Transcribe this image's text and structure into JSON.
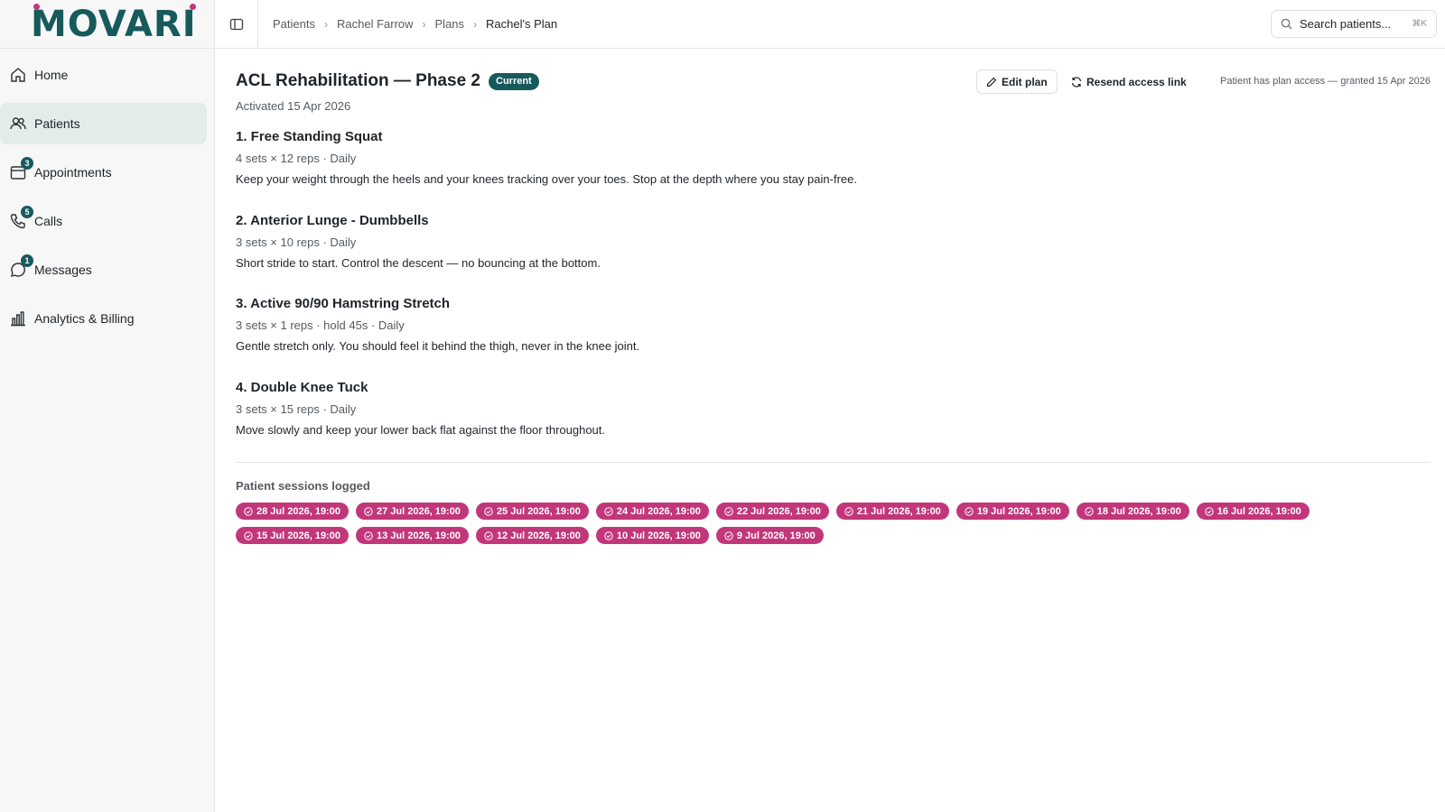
{
  "brand": {
    "name": "MOVARI",
    "accent": "#175a5c",
    "highlight": "#c2367a"
  },
  "sidebar": {
    "items": [
      {
        "label": "Home",
        "icon": "home-icon",
        "active": false
      },
      {
        "label": "Patients",
        "icon": "users-icon",
        "active": true
      },
      {
        "label": "Appointments",
        "icon": "calendar-icon",
        "badge": "3"
      },
      {
        "label": "Calls",
        "icon": "phone-icon",
        "badge": "5"
      },
      {
        "label": "Messages",
        "icon": "message-icon",
        "badge": "1"
      },
      {
        "label": "Analytics & Billing",
        "icon": "bar-chart-icon"
      }
    ]
  },
  "breadcrumb": [
    "Patients",
    "Rachel Farrow",
    "Plans",
    "Rachel's Plan"
  ],
  "search": {
    "placeholder": "Search patients...",
    "shortcut": "⌘K"
  },
  "plan": {
    "title": "ACL Rehabilitation — Phase 2",
    "status": "Current",
    "activated": "Activated 15 Apr 2026",
    "edit_label": "Edit plan",
    "resend_label": "Resend access link",
    "access_note": "Patient has plan access — granted 15 Apr 2026"
  },
  "exercises": [
    {
      "title": "1. Free Standing Squat",
      "meta": "4 sets × 12 reps · Daily",
      "desc": "Keep your weight through the heels and your knees tracking over your toes. Stop at the depth where you stay pain-free."
    },
    {
      "title": "2. Anterior Lunge - Dumbbells",
      "meta": "3 sets × 10 reps · Daily",
      "desc": "Short stride to start. Control the descent — no bouncing at the bottom."
    },
    {
      "title": "3. Active 90/90 Hamstring Stretch",
      "meta": "3 sets × 1 reps · hold 45s · Daily",
      "desc": "Gentle stretch only. You should feel it behind the thigh, never in the knee joint."
    },
    {
      "title": "4. Double Knee Tuck",
      "meta": "3 sets × 15 reps · Daily",
      "desc": "Move slowly and keep your lower back flat against the floor throughout."
    }
  ],
  "sessions": {
    "label": "Patient sessions logged",
    "items": [
      "28 Jul 2026, 19:00",
      "27 Jul 2026, 19:00",
      "25 Jul 2026, 19:00",
      "24 Jul 2026, 19:00",
      "22 Jul 2026, 19:00",
      "21 Jul 2026, 19:00",
      "19 Jul 2026, 19:00",
      "18 Jul 2026, 19:00",
      "16 Jul 2026, 19:00",
      "15 Jul 2026, 19:00",
      "13 Jul 2026, 19:00",
      "12 Jul 2026, 19:00",
      "10 Jul 2026, 19:00",
      "9 Jul 2026, 19:00"
    ]
  }
}
